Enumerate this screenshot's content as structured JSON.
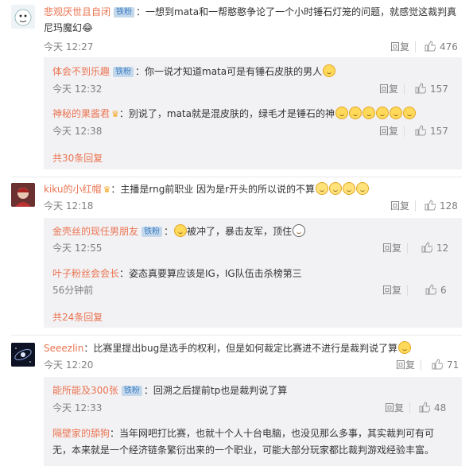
{
  "comments": [
    {
      "user": "悲观厌世且自闭",
      "badge": "铁粉",
      "text_line1": "：一想到mata和一帮憨憨争论了一个小时锤石灯笼的问题，就感觉这裁判真",
      "text_line2": "尼玛魔幻😂",
      "time": "今天 12:27",
      "reply": "回复",
      "likes": "476",
      "replies": [
        {
          "user": "体会不到乐趣",
          "badge": "铁粉",
          "text": "：你一说才知道mata可是有锤石皮肤的男人",
          "time": "今天 12:32",
          "reply": "回复",
          "likes": "157"
        },
        {
          "user": "神秘的果酱君",
          "badge": "",
          "text": "：别说了，mata就是混皮肤的，绿毛才是锤石的神",
          "time": "今天 12:38",
          "reply": "回复",
          "likes": "157"
        }
      ],
      "more": "共30条回复"
    },
    {
      "user": "kiku的小红帽",
      "text": "：主播是rng前职业 因为是r开头的所以说的不算",
      "time": "今天 12:18",
      "reply": "回复",
      "likes": "128",
      "replies": [
        {
          "user": "金壳丝的现任男朋友",
          "badge": "铁粉",
          "text": "：",
          "text_after": "被冲了，暴击友军，顶住",
          "time": "今天 12:55",
          "reply": "回复",
          "likes": "12"
        },
        {
          "user": "叶子粉丝会会长",
          "text": "：姿态真要算应该是IG，IG队伍击杀榜第三",
          "time": "56分钟前",
          "reply": "回复",
          "likes": "6"
        }
      ],
      "more": "共24条回复"
    },
    {
      "user": "Seeezlin",
      "text": "：比赛里提出bug是选手的权利，但是如何裁定比赛进不进行是裁判说了算",
      "time": "今天 12:20",
      "reply": "回复",
      "likes": "71",
      "replies": [
        {
          "user": "能所能及300张",
          "badge": "铁粉",
          "text": "：回溯之后提前tp也是裁判说了算",
          "time": "今天 12:33",
          "reply": "回复",
          "likes": "48"
        },
        {
          "user": "隔壁家的舔狗",
          "text_line1": "：当年网吧打比赛，也就十个人十台电脑，也没见那么多事，其实裁判可有可",
          "text_line2": "无，本来就是一个经济链条繁衍出来的一个职业，可能大部分玩家都比裁判游戏经验丰富。"
        }
      ]
    }
  ],
  "colors": {
    "name": "#eb7350",
    "badge_bg": "#c4d8ec",
    "badge_text": "#3f7fc2",
    "sub_bg": "#f2f2f5",
    "muted": "#808080"
  }
}
